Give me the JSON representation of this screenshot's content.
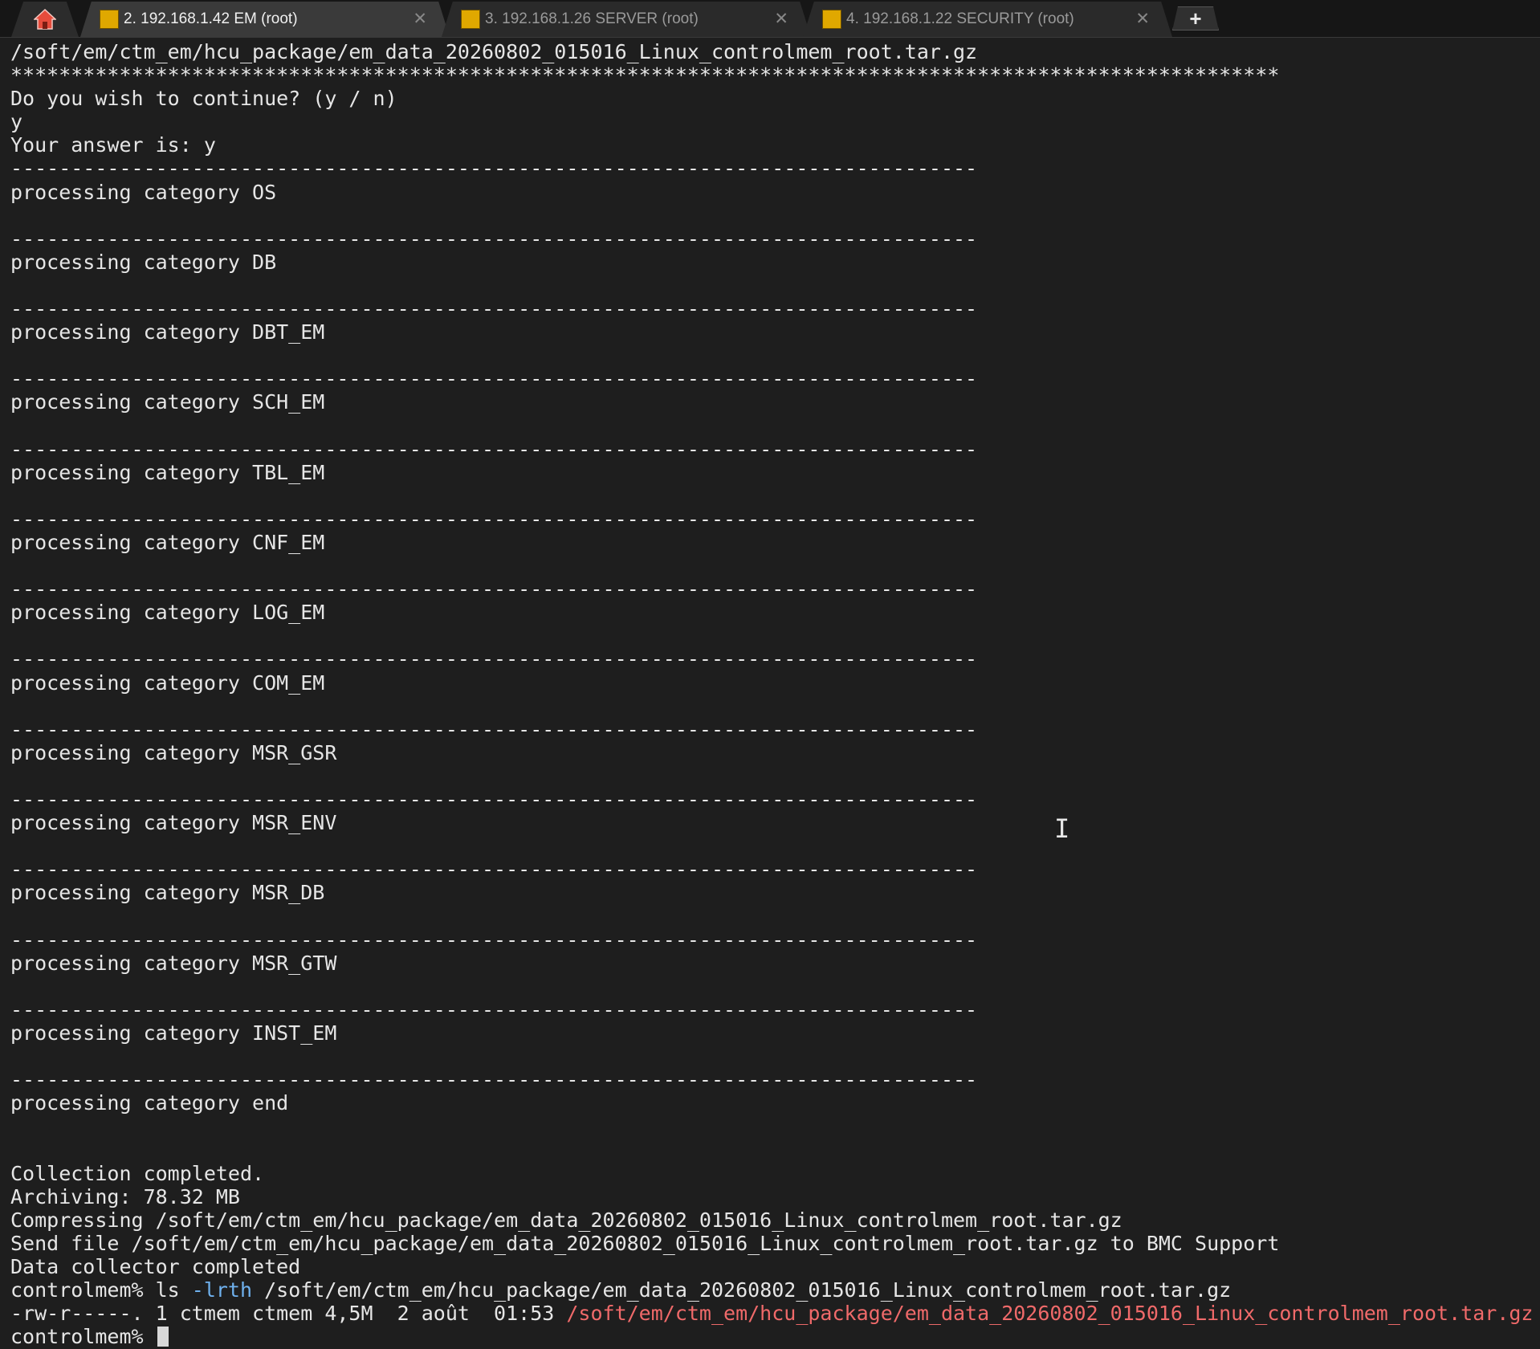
{
  "tabs": [
    {
      "label": "2. 192.168.1.42 EM (root)",
      "active": true
    },
    {
      "label": "3. 192.168.1.26 SERVER (root)",
      "active": false
    },
    {
      "label": "4. 192.168.1.22 SECURITY (root)",
      "active": false
    }
  ],
  "icons": {
    "home": "home-icon",
    "tab": "putty-icon",
    "close": "close-icon",
    "new_tab": "plus-icon",
    "mouse": "i-beam-cursor-icon"
  },
  "colors": {
    "background": "#1e1e1e",
    "text": "#e6e6e6",
    "option": "#6fb1ee",
    "file_highlight": "#f06a6a",
    "home_icon": "#e74c3c"
  },
  "terminal": {
    "lines": [
      "/soft/em/ctm_em/hcu_package/em_data_20260802_015016_Linux_controlmem_root.tar.gz",
      "*********************************************************************************************************",
      "Do you wish to continue? (y / n)",
      "y",
      "Your answer is: y",
      "--------------------------------------------------------------------------------",
      "processing category OS",
      "",
      "--------------------------------------------------------------------------------",
      "processing category DB",
      "",
      "--------------------------------------------------------------------------------",
      "processing category DBT_EM",
      "",
      "--------------------------------------------------------------------------------",
      "processing category SCH_EM",
      "",
      "--------------------------------------------------------------------------------",
      "processing category TBL_EM",
      "",
      "--------------------------------------------------------------------------------",
      "processing category CNF_EM",
      "",
      "--------------------------------------------------------------------------------",
      "processing category LOG_EM",
      "",
      "--------------------------------------------------------------------------------",
      "processing category COM_EM",
      "",
      "--------------------------------------------------------------------------------",
      "processing category MSR_GSR",
      "",
      "--------------------------------------------------------------------------------",
      "processing category MSR_ENV",
      "",
      "--------------------------------------------------------------------------------",
      "processing category MSR_DB",
      "",
      "--------------------------------------------------------------------------------",
      "processing category MSR_GTW",
      "",
      "--------------------------------------------------------------------------------",
      "processing category INST_EM",
      "",
      "--------------------------------------------------------------------------------",
      "processing category end",
      "",
      "",
      "Collection completed.",
      "Archiving: 78.32 MB",
      "Compressing /soft/em/ctm_em/hcu_package/em_data_20260802_015016_Linux_controlmem_root.tar.gz",
      "Send file /soft/em/ctm_em/hcu_package/em_data_20260802_015016_Linux_controlmem_root.tar.gz to BMC Support",
      "Data collector completed"
    ],
    "ls_line": {
      "prompt": "controlmem% ",
      "command": "ls ",
      "option": "-lrth",
      "argument": " /soft/em/ctm_em/hcu_package/em_data_20260802_015016_Linux_controlmem_root.tar.gz"
    },
    "file_line": {
      "listing": "-rw-r-----. 1 ctmem ctmem 4,5M  2 août  01:53 ",
      "filename": "/soft/em/ctm_em/hcu_package/em_data_20260802_015016_Linux_controlmem_root.tar.gz"
    },
    "final_prompt": "controlmem% "
  }
}
